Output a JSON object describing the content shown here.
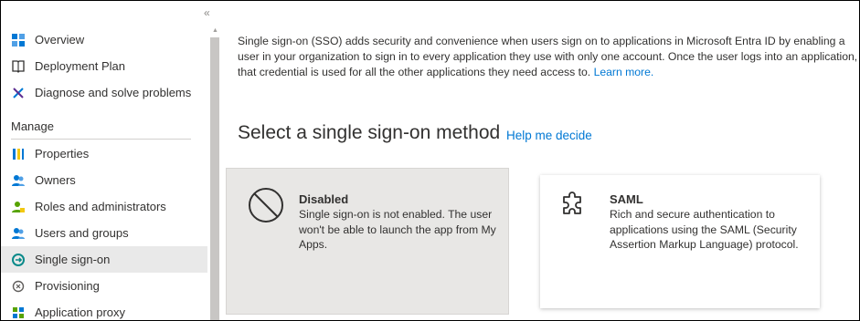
{
  "sidebar": {
    "collapse_glyph": "«",
    "items_top": [
      {
        "label": "Overview",
        "icon": "overview-icon"
      },
      {
        "label": "Deployment Plan",
        "icon": "book-icon"
      },
      {
        "label": "Diagnose and solve problems",
        "icon": "wrench-icon"
      }
    ],
    "section_header": "Manage",
    "items_manage": [
      {
        "label": "Properties",
        "icon": "properties-icon"
      },
      {
        "label": "Owners",
        "icon": "owners-icon"
      },
      {
        "label": "Roles and administrators",
        "icon": "roles-icon"
      },
      {
        "label": "Users and groups",
        "icon": "users-groups-icon"
      },
      {
        "label": "Single sign-on",
        "icon": "sso-icon",
        "selected": true
      },
      {
        "label": "Provisioning",
        "icon": "provisioning-icon"
      },
      {
        "label": "Application proxy",
        "icon": "app-proxy-icon"
      }
    ]
  },
  "main": {
    "intro_text": "Single sign-on (SSO) adds security and convenience when users sign on to applications in Microsoft Entra ID by enabling a user in your organization to sign in to every application they use with only one account. Once the user logs into an application, that credential is used for all the other applications they need access to.",
    "learn_more": "Learn more.",
    "section_title": "Select a single sign-on method",
    "help_link": "Help me decide",
    "cards": [
      {
        "title": "Disabled",
        "description": "Single sign-on is not enabled. The user won't be able to launch the app from My Apps.",
        "icon": "disabled-circle-icon",
        "selected": true
      },
      {
        "title": "SAML",
        "description": "Rich and secure authentication to applications using the SAML (Security Assertion Markup Language) protocol.",
        "icon": "puzzle-icon"
      }
    ]
  },
  "colors": {
    "link": "#0078d4",
    "selected_bg": "#e9e9e9",
    "text": "#323130"
  }
}
